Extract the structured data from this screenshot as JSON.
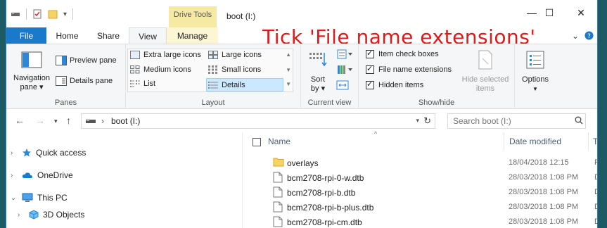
{
  "window": {
    "title": "boot (I:)",
    "contextual_tab_header": "Drive Tools",
    "controls": {
      "minimize": "—",
      "maximize": "☐",
      "close": "✕"
    }
  },
  "ribbon_tabs": [
    {
      "label": "File"
    },
    {
      "label": "Home"
    },
    {
      "label": "Share"
    },
    {
      "label": "View",
      "active": true
    },
    {
      "label": "Manage"
    }
  ],
  "annotation": "Tick 'File name extensions'",
  "ribbon": {
    "panes": {
      "navigation_pane": "Navigation",
      "navigation_pane_2": "pane",
      "preview_pane": "Preview pane",
      "details_pane": "Details pane",
      "label": "Panes"
    },
    "layout": {
      "items": [
        "Extra large icons",
        "Large icons",
        "Medium icons",
        "Small icons",
        "List",
        "Details"
      ],
      "selected": "Details",
      "label": "Layout"
    },
    "current_view": {
      "sort_by": "Sort",
      "sort_by_2": "by",
      "label": "Current view"
    },
    "show_hide": {
      "item_check_boxes": "Item check boxes",
      "file_name_extensions": "File name extensions",
      "hidden_items": "Hidden items",
      "hide_selected": "Hide selected",
      "hide_selected_2": "items",
      "label": "Show/hide",
      "checked": {
        "item_check_boxes": true,
        "file_name_extensions": true,
        "hidden_items": true
      }
    },
    "options": {
      "label": "Options"
    }
  },
  "address": {
    "path": "boot (I:)",
    "search_placeholder": "Search boot (I:)"
  },
  "nav_pane": {
    "items": [
      {
        "label": "Quick access",
        "icon": "star-icon"
      },
      {
        "label": "OneDrive",
        "icon": "cloud-icon"
      },
      {
        "label": "This PC",
        "icon": "computer-icon"
      },
      {
        "label": "3D Objects",
        "icon": "cube-icon"
      }
    ]
  },
  "file_list": {
    "columns": [
      "Name",
      "Date modified",
      "T"
    ],
    "rows": [
      {
        "name": "overlays",
        "date": "18/04/2018 12:15",
        "type": "F",
        "icon": "folder-icon"
      },
      {
        "name": "bcm2708-rpi-0-w.dtb",
        "date": "28/03/2018 1:08 PM",
        "type": "D",
        "icon": "file-icon"
      },
      {
        "name": "bcm2708-rpi-b.dtb",
        "date": "28/03/2018 1:08 PM",
        "type": "D",
        "icon": "file-icon"
      },
      {
        "name": "bcm2708-rpi-b-plus.dtb",
        "date": "28/03/2018 1:08 PM",
        "type": "D",
        "icon": "file-icon"
      },
      {
        "name": "bcm2708-rpi-cm.dtb",
        "date": "28/03/2018 1:08 PM",
        "type": "D",
        "icon": "file-icon"
      }
    ]
  },
  "colors": {
    "file_tab": "#1979ca",
    "contextual_tab": "#f6e9a4",
    "annotation": "#e01a1a",
    "selection": "#cce8ff",
    "background": "#1c5a64"
  }
}
